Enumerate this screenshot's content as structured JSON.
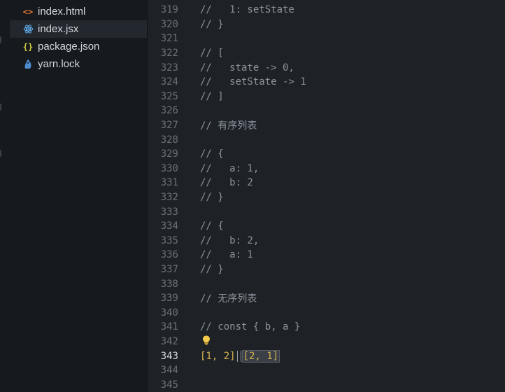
{
  "sidebar": {
    "files": [
      {
        "name": "index.html",
        "icon": "html-file-icon",
        "glyph": "<>",
        "color": "#e37933"
      },
      {
        "name": "index.jsx",
        "icon": "react-file-icon",
        "glyph": "⚛",
        "color": "#61aeee",
        "active": true
      },
      {
        "name": "package.json",
        "icon": "json-file-icon",
        "glyph": "{}",
        "color": "#cbcb41"
      },
      {
        "name": "yarn.lock",
        "icon": "yarn-file-icon",
        "glyph": "🐈",
        "color": "#4e8ccf"
      }
    ]
  },
  "editor": {
    "current_line": "343",
    "lines": [
      {
        "n": "319",
        "text": "//   1: setState"
      },
      {
        "n": "320",
        "text": "// }"
      },
      {
        "n": "321",
        "text": ""
      },
      {
        "n": "322",
        "text": "// ["
      },
      {
        "n": "323",
        "text": "//   state -> 0,"
      },
      {
        "n": "324",
        "text": "//   setState -> 1"
      },
      {
        "n": "325",
        "text": "// ]"
      },
      {
        "n": "326",
        "text": ""
      },
      {
        "n": "327",
        "text": "// 有序列表"
      },
      {
        "n": "328",
        "text": ""
      },
      {
        "n": "329",
        "text": "// {"
      },
      {
        "n": "330",
        "text": "//   a: 1,"
      },
      {
        "n": "331",
        "text": "//   b: 2"
      },
      {
        "n": "332",
        "text": "// }"
      },
      {
        "n": "333",
        "text": ""
      },
      {
        "n": "334",
        "text": "// {"
      },
      {
        "n": "335",
        "text": "//   b: 2,"
      },
      {
        "n": "336",
        "text": "//   a: 1"
      },
      {
        "n": "337",
        "text": "// }"
      },
      {
        "n": "338",
        "text": ""
      },
      {
        "n": "339",
        "text": "// 无序列表"
      },
      {
        "n": "340",
        "text": ""
      },
      {
        "n": "341",
        "text": "// const { b, a }"
      },
      {
        "n": "342",
        "text": ""
      },
      {
        "n": "343",
        "text": "",
        "code": {
          "first": "[1, 2]",
          "selected": "[2, 1]"
        }
      },
      {
        "n": "344",
        "text": ""
      },
      {
        "n": "345",
        "text": ""
      }
    ],
    "lightbulb_icon": "lightbulb-icon",
    "lightbulb_color": "#f2c94c"
  }
}
